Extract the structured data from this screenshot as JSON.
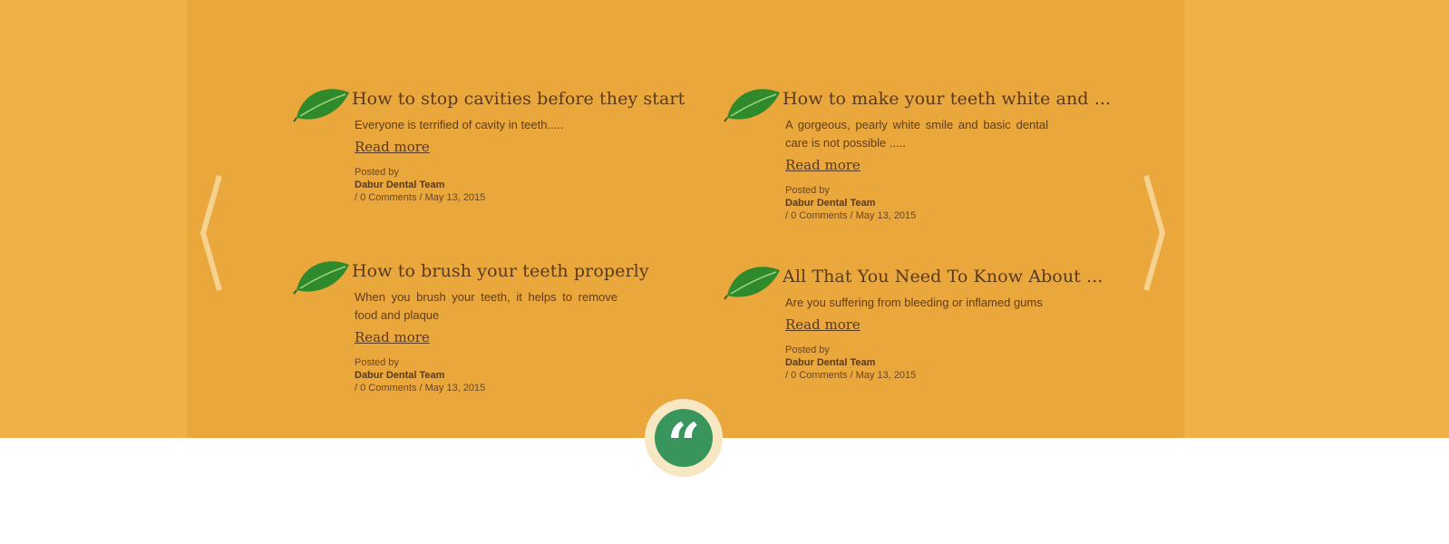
{
  "colors": {
    "outer_band": "#f0b246",
    "inner_panel": "#eaa73c",
    "title_text": "#5a3a1c",
    "quote_green": "#38965c",
    "quote_ring": "#f7e7c2"
  },
  "carousel": {
    "prev_icon": "chevron-left-icon",
    "next_icon": "chevron-right-icon"
  },
  "posts": [
    {
      "title": "How to stop cavities before they start",
      "excerpt": "Everyone is terrified of cavity in teeth.....",
      "read_more": "Read more",
      "posted_by": "Posted by",
      "author": "Dabur Dental Team",
      "stats": "/ 0 Comments / May 13, 2015"
    },
    {
      "title": "How to make your teeth white and ...",
      "excerpt": "A gorgeous, pearly white smile and basic dental care is not possible .....",
      "read_more": "Read more",
      "posted_by": "Posted by",
      "author": "Dabur Dental Team",
      "stats": "/ 0 Comments / May 13, 2015"
    },
    {
      "title": "How to brush your teeth properly",
      "excerpt": "When you brush your teeth, it helps to remove food and plaque",
      "read_more": "Read more",
      "posted_by": "Posted by",
      "author": "Dabur Dental Team",
      "stats": "/ 0 Comments / May 13, 2015"
    },
    {
      "title": "All That You Need To Know About ...",
      "excerpt": "Are you suffering from bleeding or inflamed gums",
      "read_more": "Read more",
      "posted_by": "Posted by",
      "author": "Dabur Dental Team",
      "stats": "/ 0 Comments / May 13, 2015"
    }
  ],
  "testimonial": {
    "quote_glyph": "“",
    "icon": "quote-icon"
  }
}
